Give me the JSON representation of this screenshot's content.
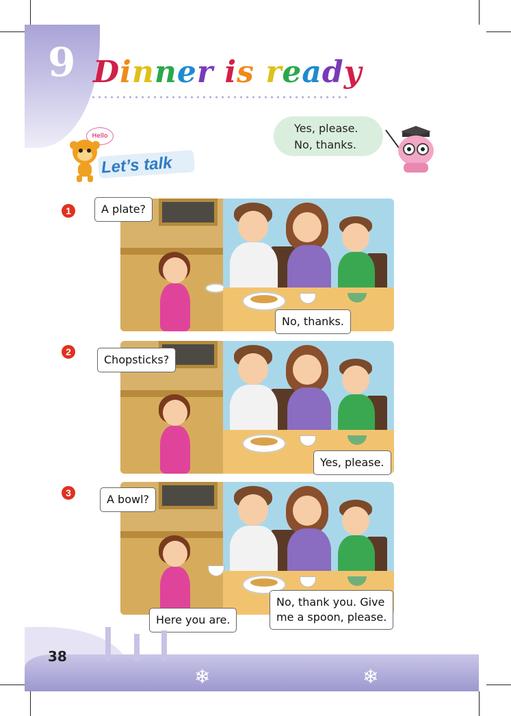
{
  "header": {
    "unit_number": "9",
    "title": "Dinner is ready",
    "title_colors": [
      "#d0204a",
      "#f08a1a",
      "#e0c01a",
      "#2aa84a",
      "#1f8ad0",
      "#7a3ab8",
      "#d0204a",
      "#f08a1a",
      "#e0c01a",
      "#2aa84a",
      "#1f8ad0",
      "#7a3ab8",
      "#d0204a",
      "#f08a1a",
      "#e0c01a"
    ]
  },
  "mascot_left": {
    "bubble": "Hello"
  },
  "section": {
    "title": "Let’s talk"
  },
  "key_phrases": {
    "line1": "Yes, please.",
    "line2": "No, thanks."
  },
  "dialogues": [
    {
      "number": "1",
      "bubbles": [
        "A plate?",
        "No, thanks."
      ]
    },
    {
      "number": "2",
      "bubbles": [
        "Chopsticks?",
        "Yes, please."
      ]
    },
    {
      "number": "3",
      "bubbles": [
        "A bowl?",
        "Here you are.",
        "No, thank you. Give",
        "me a spoon, please."
      ]
    }
  ],
  "footer": {
    "page_number": "38"
  },
  "colors": {
    "accent_red": "#e1311e",
    "lavender": "#a9a4d6",
    "sky": "#a9d7ea",
    "table": "#f2c36e"
  }
}
